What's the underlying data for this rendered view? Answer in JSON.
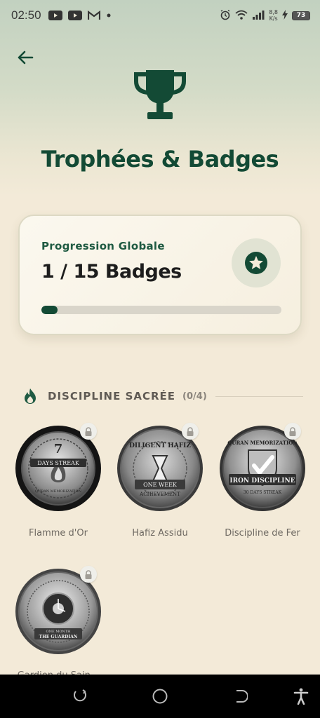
{
  "status_bar": {
    "time": "02:50",
    "network_speed_value": "8,8",
    "network_speed_unit": "K/s",
    "battery": "73",
    "icons": [
      "youtube-icon",
      "youtube-icon",
      "gmail-icon",
      "notification-dot-icon",
      "alarm-icon",
      "wifi-icon",
      "signal-icon",
      "charging-icon",
      "battery-icon"
    ]
  },
  "header": {
    "back_icon": "arrow-left-icon",
    "trophy_icon": "trophy-icon",
    "title": "Trophées & Badges"
  },
  "progress": {
    "label": "Progression Globale",
    "count": "1 / 15 Badges",
    "earned": 1,
    "total": 15,
    "icon": "star-icon"
  },
  "section": {
    "title": "DISCIPLINE SACRÉE",
    "count": "(0/4)",
    "icon": "flame-icon"
  },
  "badges": [
    {
      "label": "Flamme d'Or",
      "locked": true,
      "disc_text_top": "7",
      "disc_text_band": "DAYS STREAK",
      "disc_text_bottom": "QURAN MEMORIZATION"
    },
    {
      "label": "Hafiz Assidu",
      "locked": true,
      "disc_text_top": "DILIGENT HAFIZ",
      "disc_text_band": "ONE WEEK",
      "disc_text_bottom": "ACHIEVEMENT"
    },
    {
      "label": "Discipline de Fer",
      "locked": true,
      "disc_text_top": "QURAN MEMORIZATION",
      "disc_text_band": "IRON DISCIPLINE",
      "disc_text_bottom": "30 DAYS STREAK"
    },
    {
      "label": "Gardien du Sain...",
      "locked": true,
      "disc_text_top": "",
      "disc_text_band": "ONE MONTH",
      "disc_text_bottom": "THE GUARDIAN"
    }
  ],
  "colors": {
    "brand_green": "#134a35",
    "background": "#f3ead8",
    "muted_text": "#6e6962"
  },
  "nav": {
    "icons": [
      "recents-icon",
      "home-icon",
      "back-icon",
      "accessibility-icon"
    ]
  }
}
